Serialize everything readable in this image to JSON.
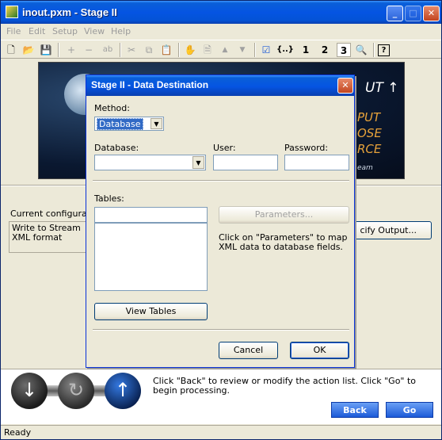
{
  "window": {
    "title": "inout.pxm - Stage II",
    "min": "_",
    "max": "□",
    "close": "✕"
  },
  "menu": [
    "File",
    "Edit",
    "Setup",
    "View",
    "Help"
  ],
  "banner": {
    "ut": "UT ↑",
    "put": "PUT",
    "ose": "OSE",
    "rce": "RCE",
    "eam": "eam"
  },
  "config": {
    "label": "Current configura",
    "text_line1": "Write to Stream",
    "text_line2": "XML format",
    "specify_output": "cify Output..."
  },
  "dialog": {
    "title": "Stage II - Data Destination",
    "close": "✕",
    "method_label": "Method:",
    "method_value": "Database",
    "database_label": "Database:",
    "database_value": "",
    "user_label": "User:",
    "user_value": "",
    "password_label": "Password:",
    "password_value": "",
    "tables_label": "Tables:",
    "tables_value": "",
    "parameters_button": "Parameters...",
    "parameters_help": "Click on \"Parameters\" to map XML data to database fields.",
    "view_tables_button": "View Tables",
    "cancel_button": "Cancel",
    "ok_button": "OK"
  },
  "wizard": {
    "help_text": "Click \"Back\" to review or modify the action list. Click \"Go\" to begin processing.",
    "back_button": "Back",
    "go_button": "Go"
  },
  "status": {
    "text": "Ready"
  }
}
